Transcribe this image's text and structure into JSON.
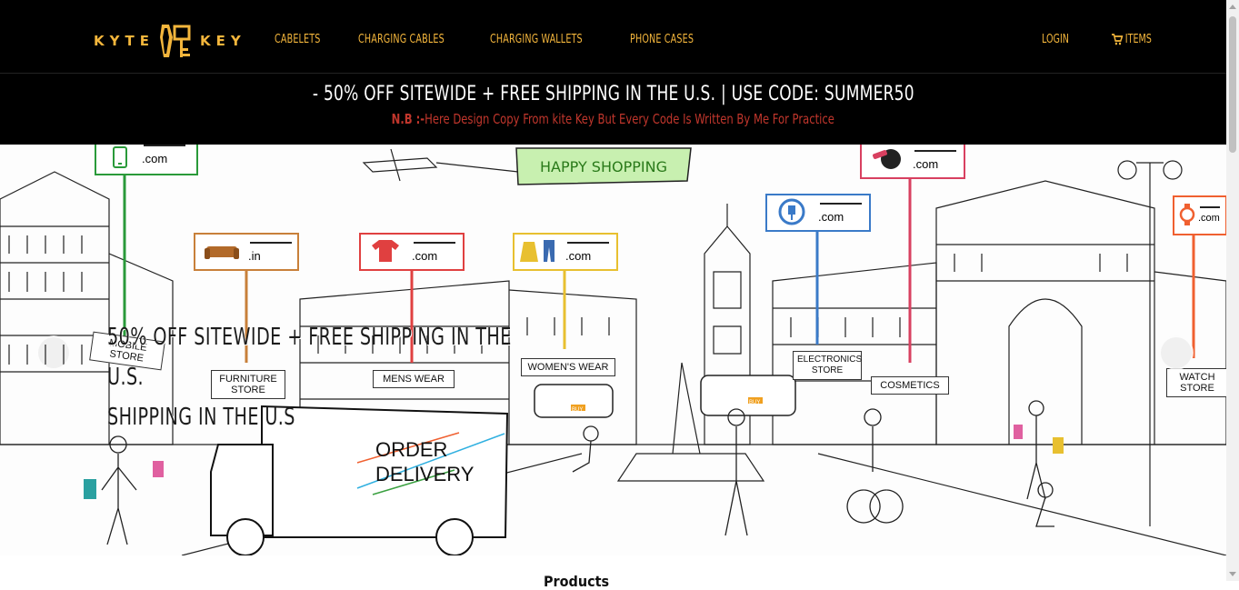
{
  "brand": {
    "left": "KYTE",
    "right": "KEY",
    "color": "#f4b63c"
  },
  "nav": {
    "links": [
      "CABELETS",
      "CHARGING CABLES",
      "CHARGING WALLETS",
      "PHONE CASES"
    ],
    "login": "LOGIN",
    "items": "ITEMS"
  },
  "promo": {
    "main": "- 50% OFF SITEWIDE + FREE SHIPPING IN THE U.S. | USE CODE: SUMMER50",
    "note_prefix": "N.B :-",
    "note_text": "Here Design Copy From kite Key But Every Code Is Written By Me For Practice"
  },
  "hero": {
    "caption_line1": "50% OFF SITEWIDE + FREE SHIPPING IN THE U.S.",
    "caption_line2": "SHIPPING IN THE U.S",
    "banner": "HAPPY SHOPPING",
    "truck_text_1": "ORDER",
    "truck_text_2": "DELIVERY",
    "tags": [
      ".com",
      ".in",
      ".com",
      ".com",
      ".com",
      ".com",
      ".com"
    ],
    "buy": "BUY",
    "stores": [
      "MOBILE STORE",
      "FURNITURE STORE",
      "MENS WEAR",
      "WOMEN'S WEAR",
      "ELECTRONICS STORE",
      "COSMETICS",
      "WATCH STORE"
    ]
  },
  "products_heading": "Products"
}
